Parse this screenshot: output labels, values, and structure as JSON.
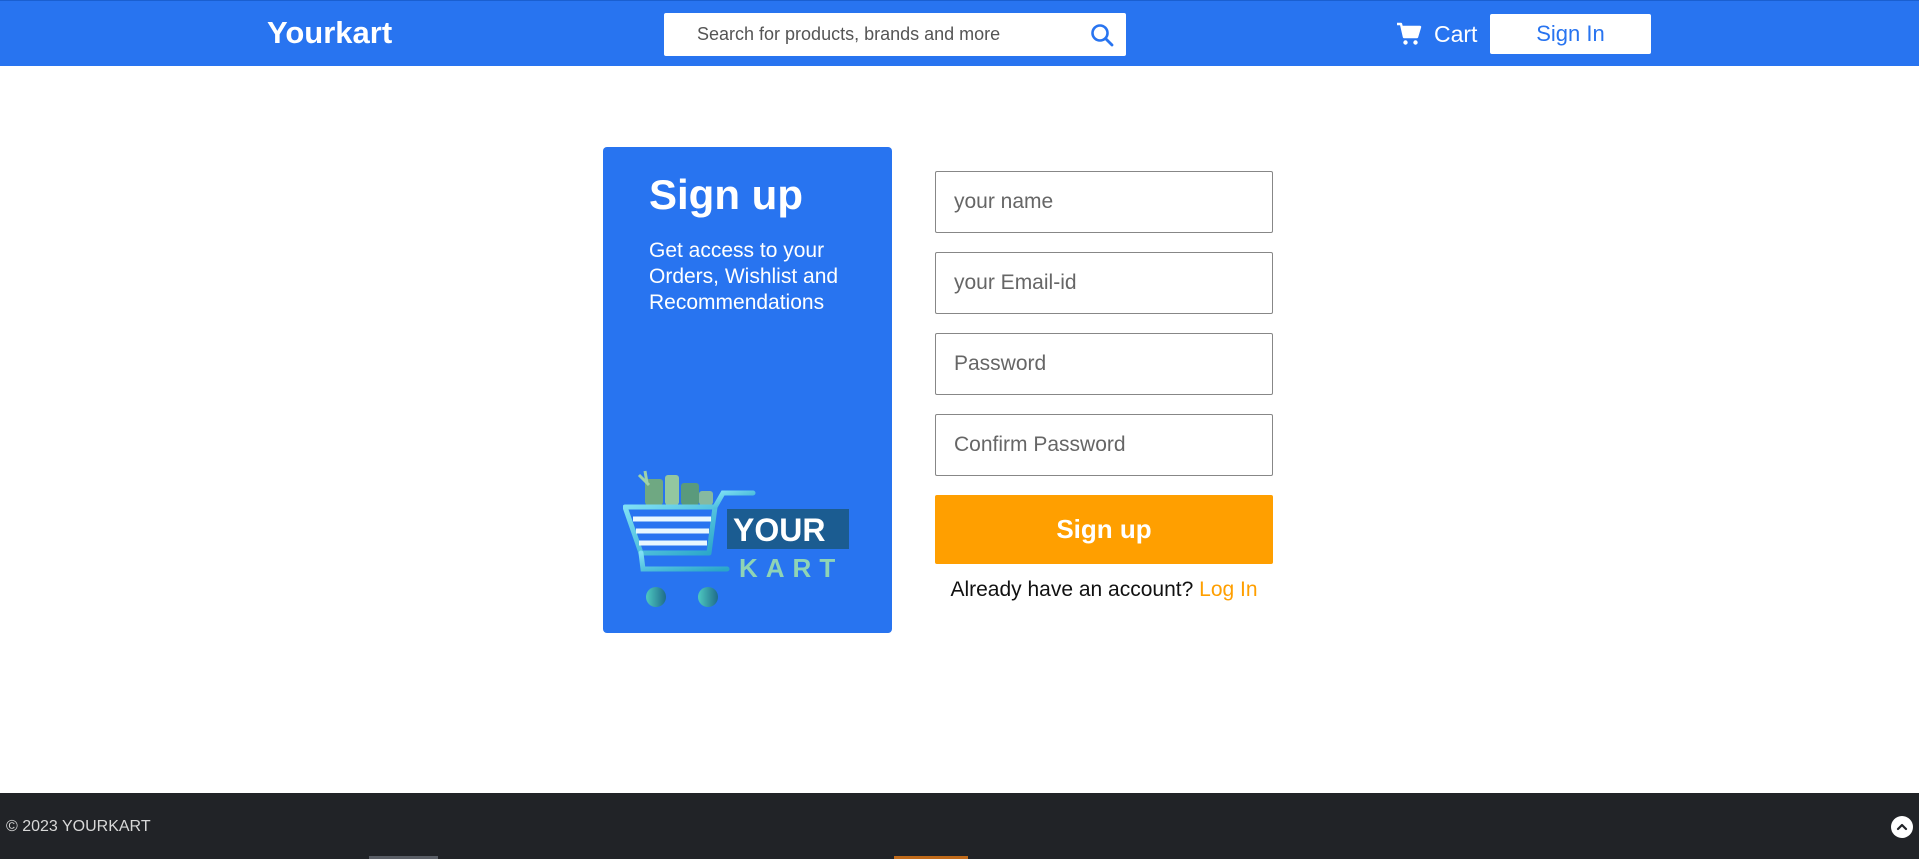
{
  "header": {
    "brand": "Yourkart",
    "search_placeholder": "Search for products, brands and more",
    "search_icon": "search-icon",
    "cart_label": "Cart",
    "cart_icon": "cart-icon",
    "signin_label": "Sign In"
  },
  "panel": {
    "title": "Sign up",
    "description": "Get access to your Orders, Wishlist and Recommendations",
    "logo_word_1": "YOUR",
    "logo_word_2": "KART"
  },
  "form": {
    "name_placeholder": "your name",
    "email_placeholder": "your Email-id",
    "password_placeholder": "Password",
    "confirm_placeholder": "Confirm Password",
    "submit_label": "Sign up",
    "login_prompt": "Already have an account?",
    "login_link": "Log In"
  },
  "footer": {
    "copyright": "© 2023 YOURKART",
    "scroll_top_icon": "chevron-up-icon"
  },
  "colors": {
    "primary": "#2874f0",
    "accent": "#ff9f00",
    "footer": "#212327"
  }
}
